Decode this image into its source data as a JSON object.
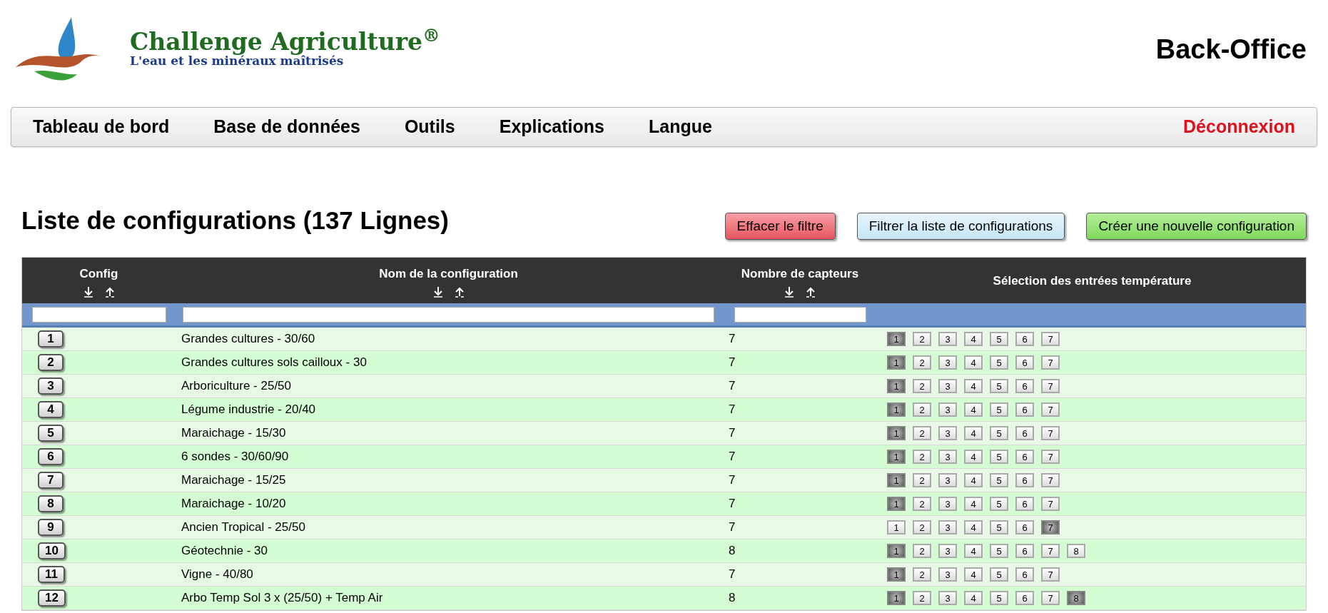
{
  "header": {
    "brand": "Challenge Agriculture$^{®}$",
    "tagline": "L'eau et les minéraux maîtrisés",
    "section": "Back-Office"
  },
  "nav": {
    "items": [
      {
        "label": "Tableau de bord"
      },
      {
        "label": "Base de données"
      },
      {
        "label": "Outils"
      },
      {
        "label": "Explications"
      },
      {
        "label": "Langue"
      }
    ],
    "logout": "Déconnexion"
  },
  "page_title": "Liste de configurations (137 Lignes)",
  "actions": [
    {
      "label": "Effacer le filtre",
      "kind": "danger"
    },
    {
      "label": "Filtrer la liste de configurations",
      "kind": "info"
    },
    {
      "label": "Créer une nouvelle configuration",
      "kind": "success"
    }
  ],
  "table": {
    "columns": [
      {
        "label": "Config",
        "kind": "sortable"
      },
      {
        "label": "Nom de la configuration",
        "kind": "sortable"
      },
      {
        "label": "Nombre de capteurs",
        "kind": "sortable"
      },
      {
        "label": "Sélection des entrées température",
        "kind": "plain"
      }
    ],
    "rows": [
      {
        "config": "1",
        "name": "Grandes cultures - 30/60",
        "count": "7",
        "inputs": [
          {
            "label": "1",
            "selected": true
          },
          {
            "label": "2",
            "selected": false
          },
          {
            "label": "3",
            "selected": false
          },
          {
            "label": "4",
            "selected": false
          },
          {
            "label": "5",
            "selected": false
          },
          {
            "label": "6",
            "selected": false
          },
          {
            "label": "7",
            "selected": false
          }
        ]
      },
      {
        "config": "2",
        "name": "Grandes cultures sols cailloux - 30",
        "count": "7",
        "inputs": [
          {
            "label": "1",
            "selected": true
          },
          {
            "label": "2",
            "selected": false
          },
          {
            "label": "3",
            "selected": false
          },
          {
            "label": "4",
            "selected": false
          },
          {
            "label": "5",
            "selected": false
          },
          {
            "label": "6",
            "selected": false
          },
          {
            "label": "7",
            "selected": false
          }
        ]
      },
      {
        "config": "3",
        "name": "Arboriculture - 25/50",
        "count": "7",
        "inputs": [
          {
            "label": "1",
            "selected": true
          },
          {
            "label": "2",
            "selected": false
          },
          {
            "label": "3",
            "selected": false
          },
          {
            "label": "4",
            "selected": false
          },
          {
            "label": "5",
            "selected": false
          },
          {
            "label": "6",
            "selected": false
          },
          {
            "label": "7",
            "selected": false
          }
        ]
      },
      {
        "config": "4",
        "name": "Légume industrie - 20/40",
        "count": "7",
        "inputs": [
          {
            "label": "1",
            "selected": true
          },
          {
            "label": "2",
            "selected": false
          },
          {
            "label": "3",
            "selected": false
          },
          {
            "label": "4",
            "selected": false
          },
          {
            "label": "5",
            "selected": false
          },
          {
            "label": "6",
            "selected": false
          },
          {
            "label": "7",
            "selected": false
          }
        ]
      },
      {
        "config": "5",
        "name": "Maraichage - 15/30",
        "count": "7",
        "inputs": [
          {
            "label": "1",
            "selected": true
          },
          {
            "label": "2",
            "selected": false
          },
          {
            "label": "3",
            "selected": false
          },
          {
            "label": "4",
            "selected": false
          },
          {
            "label": "5",
            "selected": false
          },
          {
            "label": "6",
            "selected": false
          },
          {
            "label": "7",
            "selected": false
          }
        ]
      },
      {
        "config": "6",
        "name": "6 sondes - 30/60/90",
        "count": "7",
        "inputs": [
          {
            "label": "1",
            "selected": true
          },
          {
            "label": "2",
            "selected": false
          },
          {
            "label": "3",
            "selected": false
          },
          {
            "label": "4",
            "selected": false
          },
          {
            "label": "5",
            "selected": false
          },
          {
            "label": "6",
            "selected": false
          },
          {
            "label": "7",
            "selected": false
          }
        ]
      },
      {
        "config": "7",
        "name": "Maraichage - 15/25",
        "count": "7",
        "inputs": [
          {
            "label": "1",
            "selected": true
          },
          {
            "label": "2",
            "selected": false
          },
          {
            "label": "3",
            "selected": false
          },
          {
            "label": "4",
            "selected": false
          },
          {
            "label": "5",
            "selected": false
          },
          {
            "label": "6",
            "selected": false
          },
          {
            "label": "7",
            "selected": false
          }
        ]
      },
      {
        "config": "8",
        "name": "Maraichage - 10/20",
        "count": "7",
        "inputs": [
          {
            "label": "1",
            "selected": true
          },
          {
            "label": "2",
            "selected": false
          },
          {
            "label": "3",
            "selected": false
          },
          {
            "label": "4",
            "selected": false
          },
          {
            "label": "5",
            "selected": false
          },
          {
            "label": "6",
            "selected": false
          },
          {
            "label": "7",
            "selected": false
          }
        ]
      },
      {
        "config": "9",
        "name": "Ancien Tropical - 25/50",
        "count": "7",
        "inputs": [
          {
            "label": "1",
            "selected": false
          },
          {
            "label": "2",
            "selected": false
          },
          {
            "label": "3",
            "selected": false
          },
          {
            "label": "4",
            "selected": false
          },
          {
            "label": "5",
            "selected": false
          },
          {
            "label": "6",
            "selected": false
          },
          {
            "label": "7",
            "selected": true
          }
        ]
      },
      {
        "config": "10",
        "name": "Géotechnie - 30",
        "count": "8",
        "inputs": [
          {
            "label": "1",
            "selected": true
          },
          {
            "label": "2",
            "selected": false
          },
          {
            "label": "3",
            "selected": false
          },
          {
            "label": "4",
            "selected": false
          },
          {
            "label": "5",
            "selected": false
          },
          {
            "label": "6",
            "selected": false
          },
          {
            "label": "7",
            "selected": false
          },
          {
            "label": "8",
            "selected": false
          }
        ]
      },
      {
        "config": "11",
        "name": "Vigne - 40/80",
        "count": "7",
        "inputs": [
          {
            "label": "1",
            "selected": true
          },
          {
            "label": "2",
            "selected": false
          },
          {
            "label": "3",
            "selected": false
          },
          {
            "label": "4",
            "selected": false
          },
          {
            "label": "5",
            "selected": false
          },
          {
            "label": "6",
            "selected": false
          },
          {
            "label": "7",
            "selected": false
          }
        ]
      },
      {
        "config": "12",
        "name": "Arbo Temp Sol 3 x (25/50) + Temp Air",
        "count": "8",
        "inputs": [
          {
            "label": "1",
            "selected": true
          },
          {
            "label": "2",
            "selected": false
          },
          {
            "label": "3",
            "selected": false
          },
          {
            "label": "4",
            "selected": false
          },
          {
            "label": "5",
            "selected": false
          },
          {
            "label": "6",
            "selected": false
          },
          {
            "label": "7",
            "selected": false
          },
          {
            "label": "8",
            "selected": true
          }
        ]
      }
    ]
  }
}
